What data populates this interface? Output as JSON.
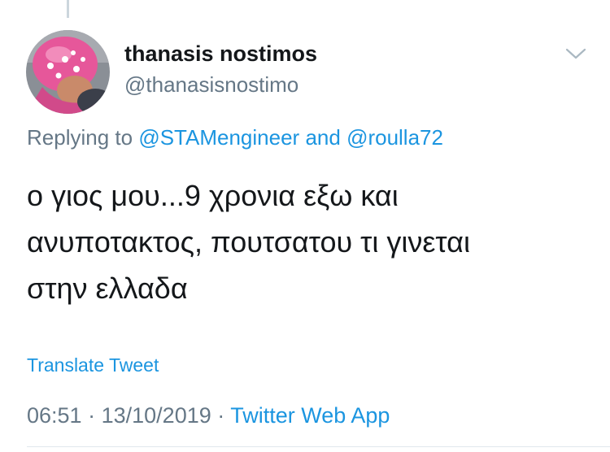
{
  "tweet": {
    "display_name": "thanasis nostimos",
    "handle": "@thanasisnostimo",
    "reply": {
      "prefix": "Replying to",
      "user1": "@STAMengineer",
      "conjunction": "and",
      "user2": "@roulla72"
    },
    "text_lines": [
      "ο γιος μου...9 χρονια εξω και",
      "ανυποτακτος, πουτσατου τι γινεται",
      "στην ελλαδα"
    ],
    "translate_label": "Translate Tweet",
    "time": "06:51",
    "separator": "·",
    "date": "13/10/2019",
    "source": "Twitter Web App"
  },
  "icons": {
    "avatar": "avatar-photo-pink-hat",
    "more": "chevron-down-icon"
  },
  "colors": {
    "link": "#1b95e0",
    "secondary_text": "#657786",
    "primary_text": "#14171a",
    "divider": "#e1e8ed"
  }
}
